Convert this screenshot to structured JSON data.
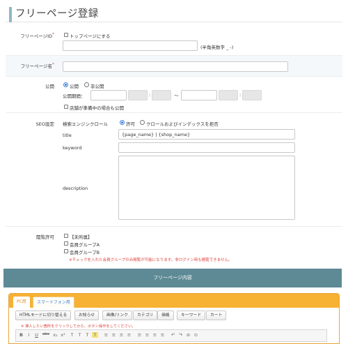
{
  "header": {
    "title": "フリーページ登録"
  },
  "page_id": {
    "label": "フリーページID",
    "required_mark": "*",
    "top_page_checkbox": "トップページにする",
    "input_value": "",
    "hint": "(半角英数字 _ -)"
  },
  "page_name": {
    "label": "フリーページ名",
    "required_mark": "*",
    "input_value": ""
  },
  "publish": {
    "label": "公開",
    "option_public": "公開",
    "option_private": "非公開",
    "selected": "公開",
    "period_label": "公開期間：",
    "colon": ":",
    "tilde": "〜",
    "closed_store_checkbox": "店舗が準備中の場合も公開"
  },
  "seo": {
    "label": "SEO設定",
    "crawl_label": "検索エンジンクロール",
    "option_allow": "許可",
    "option_deny": "クロールおよびインデックスを拒否",
    "selected": "許可",
    "title_label": "title",
    "title_value": "{page_name} | {shop_name}",
    "keyword_label": "keyword",
    "keyword_value": "",
    "description_label": "description",
    "description_value": ""
  },
  "access": {
    "label": "閲覧許可",
    "groups": [
      "【未所属】",
      "会員グループA",
      "会員グループB"
    ],
    "note": "※チェックを入れた会員グループのみ閲覧が可能になります。非ログイン時も閲覧できません。"
  },
  "content_section": {
    "title": "フリーページ内容"
  },
  "content_tabs": {
    "pc": "PC用",
    "smartphone": "スマートフォン用",
    "active": "PC用"
  },
  "editor_toolbar": {
    "buttons": [
      "HTMLモードに切り替える",
      "お知らせ",
      "画像/リンク",
      "カテゴリ",
      "価格",
      "キーワード",
      "カート"
    ],
    "note": "※ 挿入したい箇所をクリックしてから、ボタン操作をしてください。",
    "icons": [
      "B",
      "I",
      "U",
      "abe",
      "x₂",
      "x²",
      "T",
      "T",
      "T",
      "T",
      "≡",
      "≡",
      "≡",
      "≡",
      "≡",
      "≡",
      "≡",
      "≡",
      "↶",
      "↷",
      "⊘",
      "⊙"
    ]
  },
  "colors": {
    "accent": "#5d8a95",
    "tab_bar": "#f7b133",
    "required": "#e05a5a",
    "note": "#d9463f",
    "link": "#3c7fd6"
  }
}
